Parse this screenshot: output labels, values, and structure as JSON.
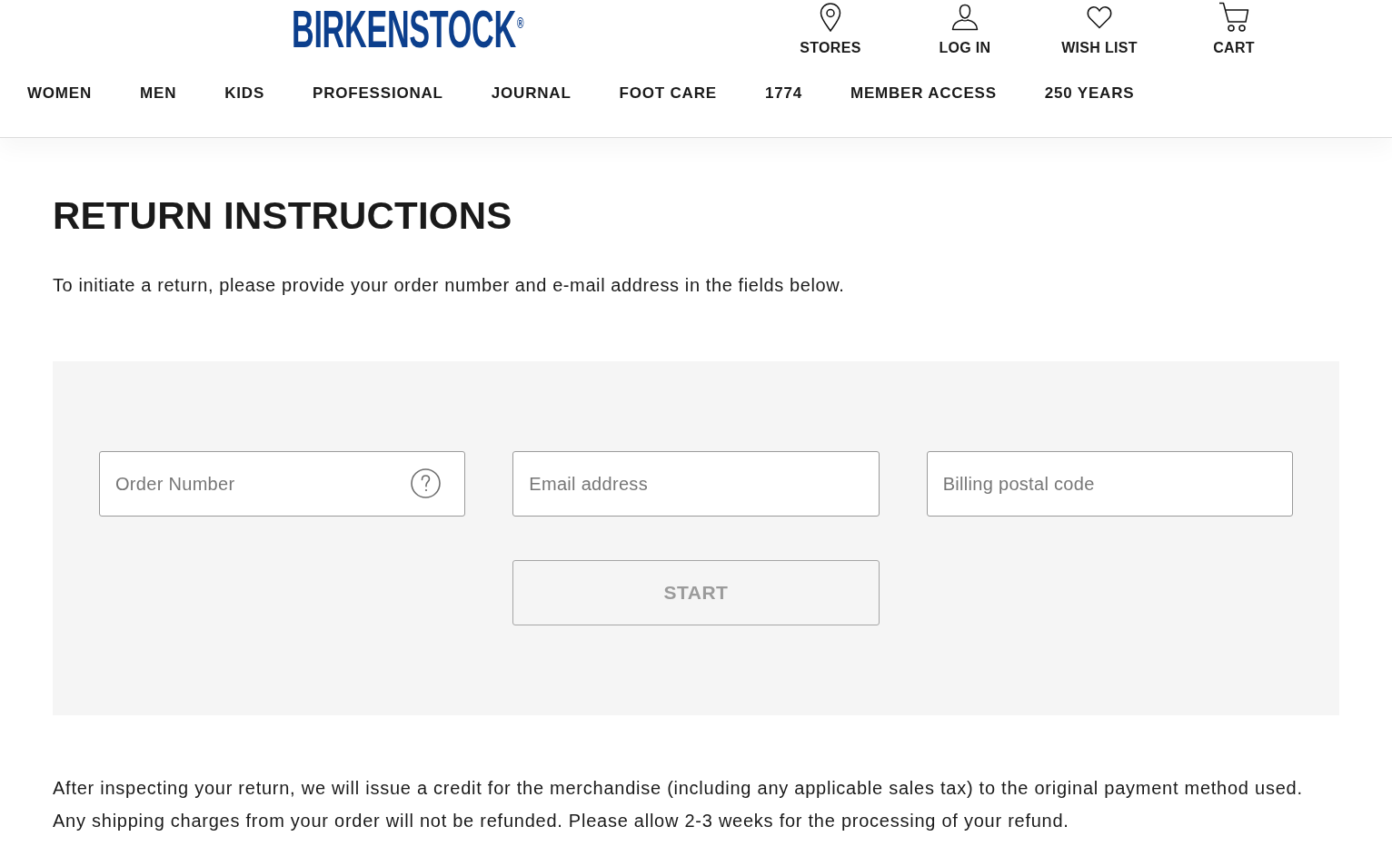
{
  "header": {
    "logo": "BIRKENSTOCK$^{®}$",
    "utility_links": [
      {
        "kind": "stores",
        "label": "STORES"
      },
      {
        "kind": "account",
        "label": "LOG IN"
      },
      {
        "kind": "wishlist",
        "label": "WISH LIST"
      },
      {
        "kind": "cart",
        "label": "CART"
      }
    ]
  },
  "nav": {
    "items": [
      "WOMEN",
      "MEN",
      "KIDS",
      "PROFESSIONAL",
      "JOURNAL",
      "FOOT CARE",
      "1774",
      "MEMBER ACCESS",
      "250 YEARS"
    ]
  },
  "page": {
    "title": "RETURN INSTRUCTIONS",
    "intro": "To initiate a return, please provide your order number and e-mail address in the fields below."
  },
  "form": {
    "fields": [
      {
        "placeholder": "Order Number",
        "has_help": true
      },
      {
        "placeholder": "Email address",
        "has_help": false
      },
      {
        "placeholder": "Billing postal code",
        "has_help": false
      }
    ],
    "submit": {
      "label": "START",
      "disabled": true
    }
  },
  "note": "After inspecting your return, we will issue a credit for the merchandise (including any applicable sales tax) to the original payment method used. Any shipping charges from your order will not be refunded. Please allow 2-3 weeks for the processing of your refund."
}
